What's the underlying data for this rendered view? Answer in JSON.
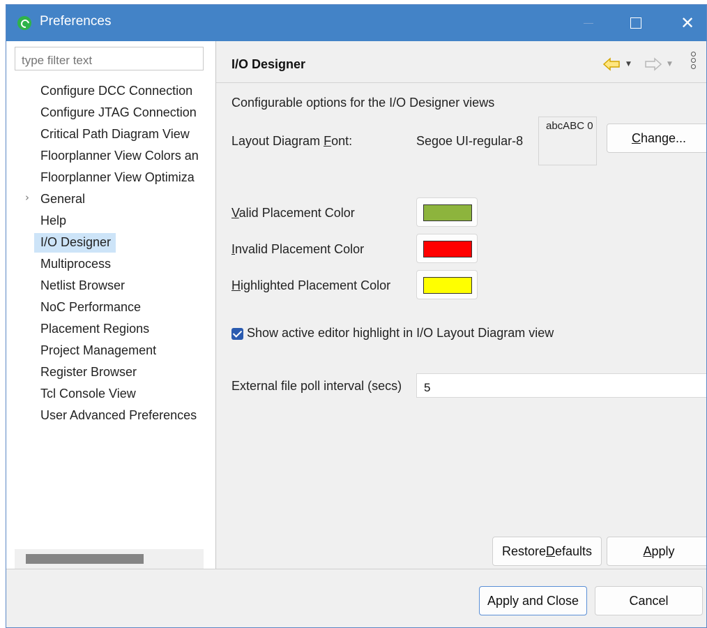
{
  "window": {
    "title": "Preferences"
  },
  "filter": {
    "placeholder": "type filter text"
  },
  "tree": {
    "items": [
      {
        "label": "Configure DCC Connection"
      },
      {
        "label": "Configure JTAG Connection"
      },
      {
        "label": "Critical Path Diagram View"
      },
      {
        "label": "Floorplanner View Colors an"
      },
      {
        "label": "Floorplanner View Optimiza"
      },
      {
        "label": "General",
        "expandable": true
      },
      {
        "label": "Help"
      },
      {
        "label": "I/O Designer",
        "selected": true
      },
      {
        "label": "Multiprocess"
      },
      {
        "label": "Netlist Browser"
      },
      {
        "label": "NoC Performance"
      },
      {
        "label": "Placement Regions"
      },
      {
        "label": "Project Management"
      },
      {
        "label": "Register Browser"
      },
      {
        "label": "Tcl Console View"
      },
      {
        "label": "User Advanced Preferences"
      }
    ],
    "expander_glyph": "›"
  },
  "page": {
    "title": "I/O Designer",
    "description": "Configurable options for the I/O Designer views",
    "font": {
      "label_pre": "Layout Diagram ",
      "label_mnemonic": "F",
      "label_post": "ont:",
      "value": "Segoe UI-regular-8",
      "preview": "abcABC 0",
      "change_pre": "",
      "change_mnemonic": "C",
      "change_post": "hange..."
    },
    "colors": [
      {
        "mnemonic": "V",
        "rest": "alid Placement Color",
        "color": "#8db43d"
      },
      {
        "mnemonic": "I",
        "rest": "nvalid Placement Color",
        "color": "#ff0000"
      },
      {
        "mnemonic": "H",
        "rest": "ighlighted Placement Color",
        "color": "#ffff00"
      }
    ],
    "highlight_checkbox": {
      "checked": true,
      "label": "Show active editor highlight in I/O Layout Diagram view"
    },
    "poll": {
      "label": "External file poll interval (secs)",
      "value": "5"
    },
    "restore": {
      "pre": "Restore ",
      "mnemonic": "D",
      "post": "efaults"
    },
    "apply": {
      "pre": "",
      "mnemonic": "A",
      "post": "pply"
    }
  },
  "footer": {
    "apply_close": "Apply and Close",
    "cancel": "Cancel"
  },
  "icons": {
    "back": "back-arrow-icon",
    "forward": "forward-arrow-icon",
    "close": "✕"
  },
  "colors": {
    "titlebar": "#4383c7",
    "selection": "#cde4f8",
    "back_arrow": "#f5c400"
  }
}
